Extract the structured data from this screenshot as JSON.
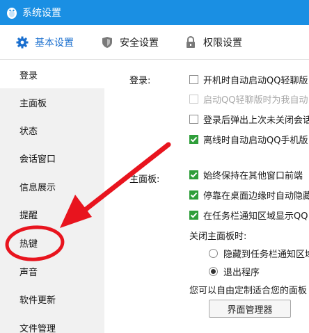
{
  "window": {
    "title": "系统设置"
  },
  "tabs": [
    {
      "label": "基本设置",
      "icon": "gear-icon",
      "active": true
    },
    {
      "label": "安全设置",
      "icon": "shield-icon"
    },
    {
      "label": "权限设置",
      "icon": "lock-icon"
    }
  ],
  "sidebar": {
    "items": [
      {
        "label": "登录"
      },
      {
        "label": "主面板"
      },
      {
        "label": "状态"
      },
      {
        "label": "会话窗口"
      },
      {
        "label": "信息展示"
      },
      {
        "label": "提醒"
      },
      {
        "label": "热键"
      },
      {
        "label": "声音"
      },
      {
        "label": "软件更新"
      },
      {
        "label": "文件管理"
      }
    ]
  },
  "login": {
    "label": "登录:",
    "options": [
      {
        "text": "开机时自动启动QQ轻聊版",
        "checked": false,
        "disabled": false
      },
      {
        "text": "启动QQ轻聊版时为我自动",
        "checked": false,
        "disabled": true
      },
      {
        "text": "登录后弹出上次未关闭会话",
        "checked": false,
        "disabled": false
      },
      {
        "text": "离线时自动启动QQ手机版",
        "checked": true,
        "disabled": false
      }
    ]
  },
  "main_panel": {
    "label": "主面板:",
    "options": [
      {
        "text": "始终保持在其他窗口前端",
        "checked": true
      },
      {
        "text": "停靠在桌面边缘时自动隐藏",
        "checked": true
      },
      {
        "text": "在任务栏通知区域显示QQ",
        "checked": true
      }
    ],
    "close_label": "关闭主面板时:",
    "close_options": [
      {
        "text": "隐藏到任务栏通知区域",
        "checked": false
      },
      {
        "text": "退出程序",
        "checked": true
      }
    ],
    "customize_text": "您可以自由定制适合您的面板",
    "interface_button": "界面管理器"
  },
  "colors": {
    "titlebar": "#1a8fe3",
    "accent": "#1a6fcf",
    "check": "#2f9e3a",
    "annotation": "#e8141e"
  }
}
